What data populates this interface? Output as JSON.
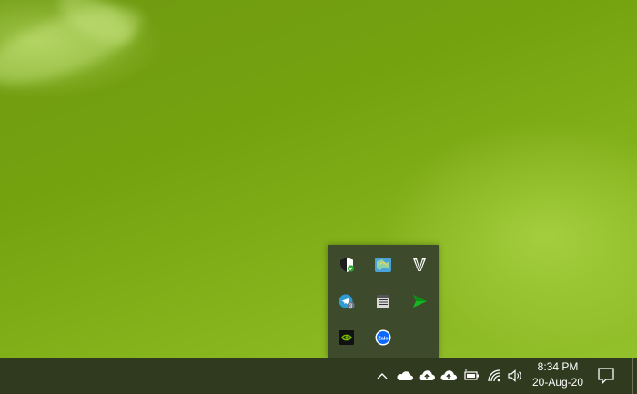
{
  "taskbar": {
    "clock": {
      "time": "8:34 PM",
      "date": "20-Aug-20"
    }
  },
  "tray": {
    "hidden_icons": [
      "windows-security-icon",
      "map-app-icon",
      "v-app-icon",
      "telegram-icon",
      "notes-app-icon",
      "send-arrow-icon",
      "nvidia-icon",
      "zalo-icon"
    ],
    "zalo_label": "Zalo",
    "v_label": "V"
  },
  "colors": {
    "taskbar": "#2f3a1e",
    "flyout": "#3d4a2c",
    "desktop": "#74a20f"
  }
}
